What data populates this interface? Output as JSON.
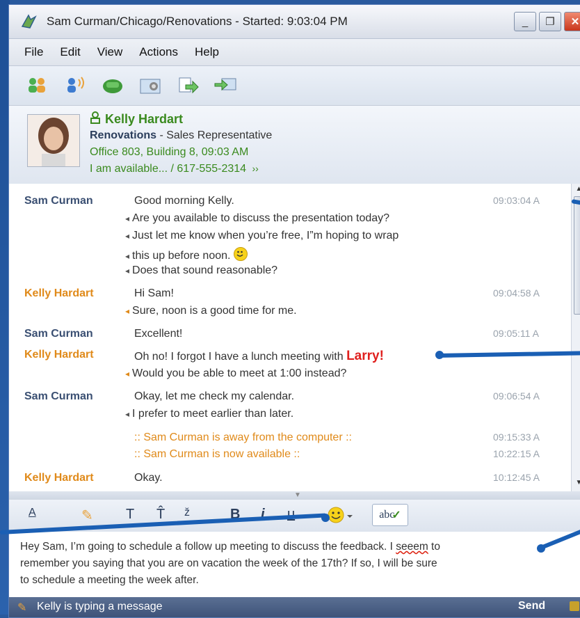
{
  "window": {
    "title": "Sam Curman/Chicago/Renovations - Started: 9:03:04 PM",
    "min": "_",
    "restore": "❐",
    "close": "✕"
  },
  "menu": [
    "File",
    "Edit",
    "View",
    "Actions",
    "Help"
  ],
  "toolbar_icons": [
    "invite-people-icon",
    "audio-call-icon",
    "phone-icon",
    "screen-share-icon",
    "send-file-icon",
    "transfer-icon"
  ],
  "contact": {
    "name": "Kelly Hardart",
    "department": "Renovations",
    "role_sep": " - Sales Representative",
    "location": "Office 803, Building 8, 09:03 AM",
    "status": "I am available... / 617-555-2314",
    "status_more": "››"
  },
  "chat": {
    "sam_name": "Sam Curman",
    "kelly_name": "Kelly Hardart",
    "m1": "Good morning Kelly.",
    "t1": "09:03:04 A",
    "m1b": "Are you available to discuss the presentation today?",
    "m1c": "Just let me know when you’re free, I”m hoping to wrap",
    "m1d": "this up before noon.",
    "m1e": "Does that sound reasonable?",
    "m2": "Hi Sam!",
    "t2": "09:04:58 A",
    "m2b": "Sure, noon is a good time for me.",
    "m3": "Excellent!",
    "t3": "09:05:11 A",
    "m4": "Oh no! I forgot I have a lunch meeting with",
    "m4_emph": "Larry!",
    "m4b": "Would you be able to meet at 1:00 instead?",
    "m5": "Okay, let me check my calendar.",
    "t5": "09:06:54 A",
    "m5b": "I prefer to meet earlier than later.",
    "sys1": ":: Sam Curman is away from the computer ::",
    "ts1": "09:15:33 A",
    "sys2": ":: Sam Curman is now available ::",
    "ts2": "10:22:15 A",
    "m6": "Okay.",
    "t6": "10:12:45 A"
  },
  "format": {
    "font_color": "A",
    "highlight": "✎",
    "text_smaller": "T",
    "text_bigger": "T̂",
    "text_reset": "ž",
    "bold": "B",
    "italic": "i",
    "underline": "u",
    "spell": "abc"
  },
  "input": {
    "line1_pre": "Hey Sam, I’m going to schedule a follow up meeting to discuss the feedback. I ",
    "misspelled": "seeem",
    "line1_post": " to",
    "line2": "remember you saying that you are on vacation the week of the 17th? If so, I will be sure",
    "line3": "to schedule a meeting the week after."
  },
  "status": {
    "typing": "Kelly is typing a message",
    "send": "Send"
  },
  "colors": {
    "sam": "#3a4f72",
    "kelly": "#e08a1a",
    "emphasis": "#e0201e",
    "presence": "#3a8a1e"
  }
}
